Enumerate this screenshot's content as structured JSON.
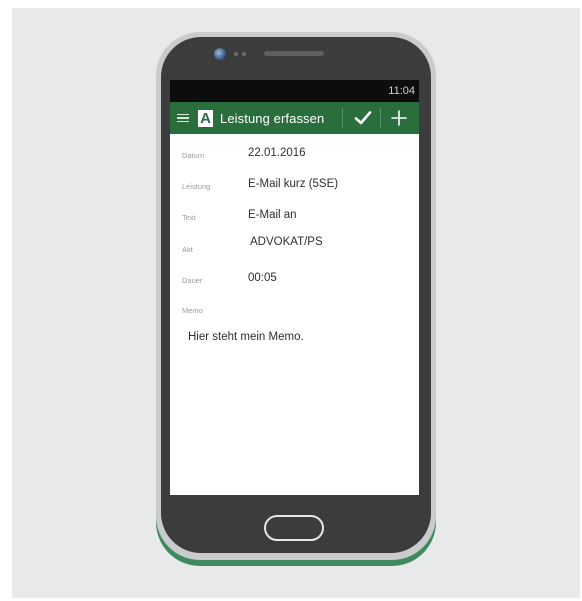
{
  "device": {
    "status_time": "11:04"
  },
  "app_bar": {
    "logo_letter": "A",
    "title": "Leistung erfassen",
    "accent_color": "#2b6e3e",
    "icons": [
      "menu-icon",
      "check-icon",
      "plus-icon"
    ]
  },
  "form": {
    "fields": [
      {
        "label": "Datum",
        "value": "22.01.2016"
      },
      {
        "label": "Leistung",
        "value": "E-Mail kurz (5SE)"
      },
      {
        "label": "Text",
        "value": "E-Mail an"
      },
      {
        "label": "Akt",
        "value": "ADVOKAT/PS"
      },
      {
        "label": "Dauer",
        "value": "00:05"
      }
    ],
    "memo_label": "Memo",
    "memo_value": "Hier steht mein Memo."
  }
}
